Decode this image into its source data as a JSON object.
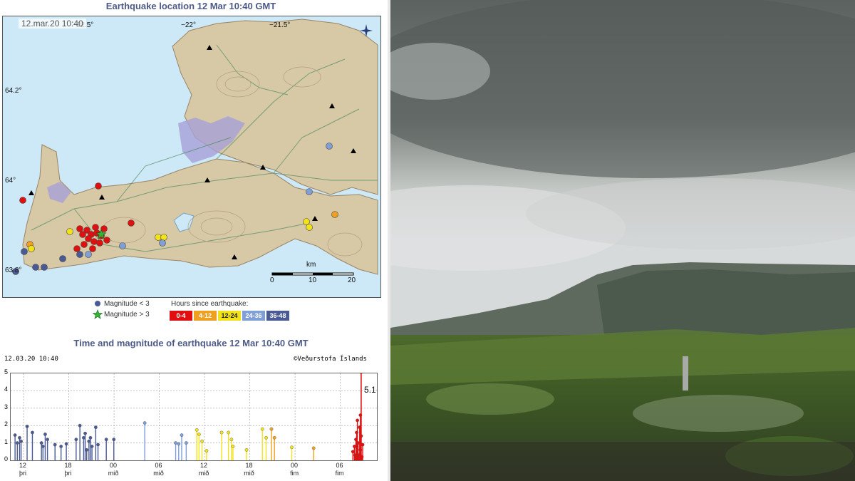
{
  "map": {
    "title": "Earthquake location   12 Mar 10:40 GMT",
    "date_stamp": "12.mar.20  10:40",
    "lon_labels": [
      "−22.5°",
      "−22°",
      "−21.5°"
    ],
    "lat_labels": [
      "64.2°",
      "64°",
      "63.8°"
    ],
    "scale_unit": "km",
    "scale_ticks": [
      "0",
      "10",
      "20"
    ],
    "legend": {
      "small_label": "Magnitude < 3",
      "large_label": "Magnitude > 3",
      "hours_title": "Hours since earthquake:",
      "hour_bins": [
        {
          "label": "0-4",
          "color": "#e01010"
        },
        {
          "label": "4-12",
          "color": "#f0a020"
        },
        {
          "label": "12-24",
          "color": "#f2e21a"
        },
        {
          "label": "24-36",
          "color": "#7f9fd6"
        },
        {
          "label": "36-48",
          "color": "#4a5a94"
        }
      ]
    }
  },
  "plot": {
    "title": "Time and magnitude of earthquake   12 Mar 10:40 GMT",
    "date_stamp": "12.03.20 10:40",
    "credit": "©Veðurstofa Íslands",
    "peak_label": "5.1"
  },
  "chart_data": {
    "type": "scatter",
    "title": "Time and magnitude of earthquake   12 Mar 10:40 GMT",
    "xlabel": "",
    "ylabel": "",
    "ylim": [
      0,
      5
    ],
    "yticks": [
      "0",
      "1",
      "2",
      "3",
      "4",
      "5"
    ],
    "xlim": [
      0,
      48
    ],
    "x_units": "hours since 10 Mar 10:40 GMT",
    "xticks": [
      {
        "x": 1.33,
        "label": "12",
        "day": "þri"
      },
      {
        "x": 7.33,
        "label": "18",
        "day": "þri"
      },
      {
        "x": 13.33,
        "label": "00",
        "day": "mið"
      },
      {
        "x": 19.33,
        "label": "06",
        "day": "mið"
      },
      {
        "x": 25.33,
        "label": "12",
        "day": "mið"
      },
      {
        "x": 31.33,
        "label": "18",
        "day": "mið"
      },
      {
        "x": 37.33,
        "label": "00",
        "day": "fim"
      },
      {
        "x": 43.33,
        "label": "06",
        "day": "fim"
      }
    ],
    "grid": true,
    "series": [
      {
        "color": "#4a5a94",
        "points": [
          [
            0.2,
            1.45
          ],
          [
            0.5,
            1.0
          ],
          [
            0.8,
            1.3
          ],
          [
            1.0,
            1.1
          ],
          [
            1.8,
            1.95
          ],
          [
            2.5,
            1.6
          ],
          [
            3.7,
            1.0
          ],
          [
            3.9,
            0.8
          ],
          [
            4.2,
            1.5
          ],
          [
            4.5,
            1.2
          ],
          [
            5.5,
            0.9
          ],
          [
            6.3,
            0.8
          ],
          [
            7.0,
            0.95
          ],
          [
            8.3,
            1.2
          ],
          [
            8.8,
            2.0
          ],
          [
            9.3,
            1.3
          ],
          [
            9.5,
            1.55
          ],
          [
            9.7,
            0.6
          ],
          [
            10.0,
            1.1
          ],
          [
            10.2,
            1.3
          ],
          [
            10.4,
            0.8
          ],
          [
            10.9,
            1.9
          ],
          [
            11.2,
            0.9
          ],
          [
            12.3,
            1.2
          ],
          [
            13.3,
            1.2
          ]
        ]
      },
      {
        "color": "#7f9fd6",
        "points": [
          [
            17.4,
            2.15
          ],
          [
            21.5,
            1.0
          ],
          [
            22.3,
            1.45
          ],
          [
            22.9,
            1.0
          ],
          [
            21.9,
            0.95
          ]
        ]
      },
      {
        "color": "#f2e21a",
        "points": [
          [
            24.3,
            1.75
          ],
          [
            24.6,
            1.5
          ],
          [
            25.0,
            1.1
          ],
          [
            25.6,
            0.55
          ],
          [
            27.6,
            1.6
          ],
          [
            28.5,
            1.6
          ],
          [
            28.9,
            1.2
          ],
          [
            29.1,
            0.8
          ],
          [
            30.9,
            0.6
          ],
          [
            33.0,
            1.8
          ],
          [
            33.5,
            1.3
          ],
          [
            36.9,
            0.75
          ]
        ]
      },
      {
        "color": "#f0a020",
        "points": [
          [
            34.2,
            1.8
          ],
          [
            34.6,
            1.3
          ],
          [
            39.8,
            0.7
          ]
        ]
      },
      {
        "color": "#e01010",
        "points": [
          [
            45.0,
            0.5
          ],
          [
            45.2,
            0.8
          ],
          [
            45.3,
            0.3
          ],
          [
            45.4,
            1.2
          ],
          [
            45.5,
            1.6
          ],
          [
            45.6,
            2.3
          ],
          [
            45.7,
            1.0
          ],
          [
            45.8,
            0.3
          ],
          [
            45.9,
            1.9
          ],
          [
            46.0,
            2.6
          ],
          [
            46.0,
            0.6
          ],
          [
            46.1,
            1.4
          ],
          [
            46.2,
            0.2
          ],
          [
            46.3,
            0.9
          ]
        ]
      }
    ],
    "main_shock": {
      "x": 46.1,
      "magnitude": 5.1
    }
  }
}
